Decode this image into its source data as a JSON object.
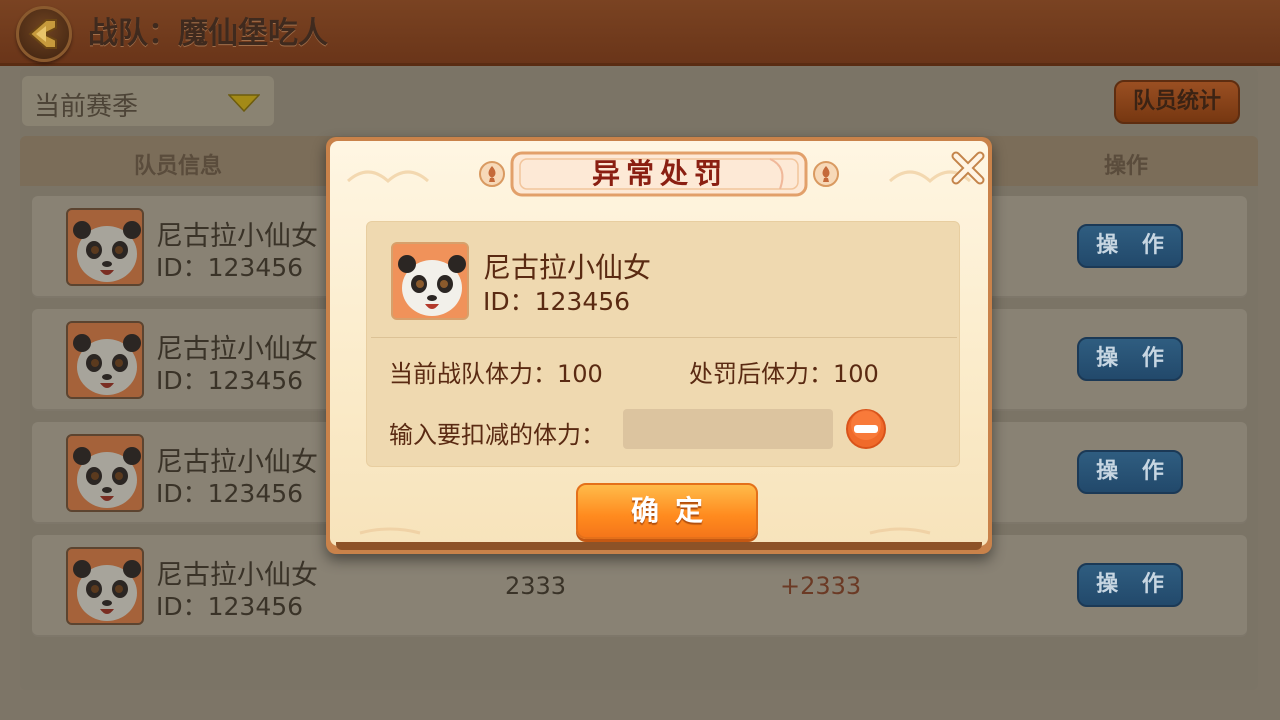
{
  "header": {
    "title": "战队：魔仙堡吃人"
  },
  "filters": {
    "season_label": "当前赛季",
    "stats_button": "队员统计"
  },
  "table": {
    "headers": [
      "队员信息",
      "操作"
    ],
    "rows": [
      {
        "name": "尼古拉小仙女",
        "id": "ID：123456",
        "value1": "",
        "value2": "",
        "action": "操 作"
      },
      {
        "name": "尼古拉小仙女",
        "id": "ID：123456",
        "value1": "",
        "value2": "",
        "action": "操 作"
      },
      {
        "name": "尼古拉小仙女",
        "id": "ID：123456",
        "value1": "",
        "value2": "",
        "action": "操 作"
      },
      {
        "name": "尼古拉小仙女",
        "id": "ID：123456",
        "value1": "2333",
        "value2": "+2333",
        "action": "操 作"
      }
    ]
  },
  "dialog": {
    "title": "异常处罚",
    "player_name": "尼古拉小仙女",
    "player_id": "ID：123456",
    "current_stamina": "当前战队体力：100",
    "after_stamina": "处罚后体力：100",
    "input_label": "输入要扣减的体力：",
    "input_value": "",
    "confirm_label": "确定"
  },
  "icons": {
    "back": "back-arrow-icon",
    "season_caret": "caret-down-icon",
    "close": "close-icon",
    "minus": "minus-icon",
    "avatar": "panda-avatar"
  },
  "colors": {
    "dialog_title": "#8a1f12",
    "confirm": "#ff8a1e",
    "action_button": "#2f5d80",
    "minus": "#f06a2a"
  }
}
